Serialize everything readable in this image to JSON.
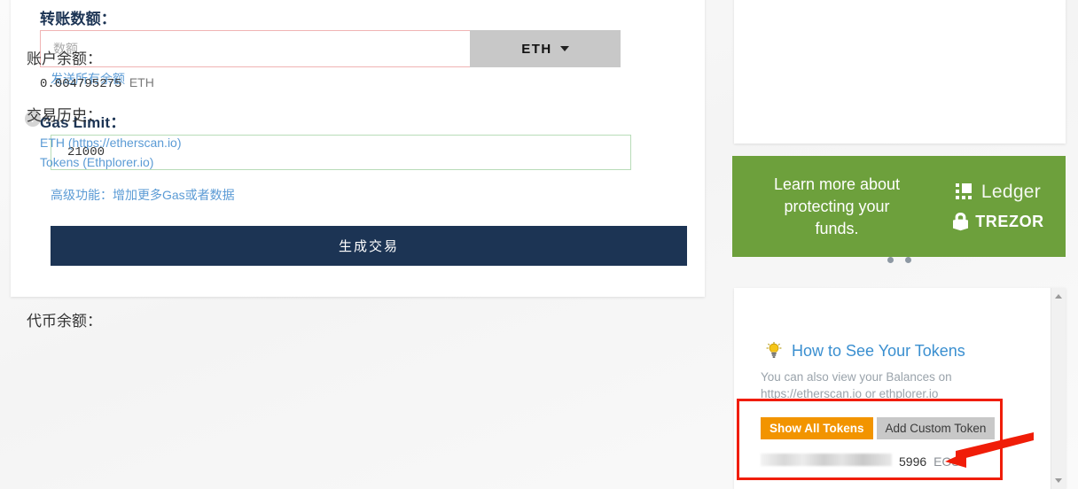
{
  "send_form": {
    "amount_label": "转账数额：",
    "amount_placeholder": "数额",
    "amount_value": "",
    "unit_button": "ETH",
    "send_all_link": "发送所有余额",
    "gas_label": "Gas Limit：",
    "gas_help_icon": "question-mark-icon",
    "gas_value": "21000",
    "advanced_link": "高级功能：增加更多Gas或者数据",
    "generate_button": "生成交易"
  },
  "balance_card": {
    "balance_heading": "账户余额：",
    "balance_value": "0.004795275",
    "balance_unit": "ETH",
    "history_heading": "交易历史：",
    "history_links": [
      "ETH (https://etherscan.io)",
      "Tokens (Ethplorer.io)"
    ]
  },
  "promo": {
    "text_line1": "Learn more about",
    "text_line2": "protecting your",
    "text_line3": "funds.",
    "ledger_label": "Ledger",
    "trezor_label": "TREZOR",
    "background_color": "#6da03c",
    "dots": 2,
    "active_dot_index": 1
  },
  "token_card": {
    "heading": "代币余额：",
    "how_to_link": "How to See Your Tokens",
    "bulb_icon": "lightbulb-icon",
    "note_line1": "You can also view your Balances on",
    "note_line2": "https://etherscan.io or ethplorer.io",
    "show_all_button": "Show All Tokens",
    "add_custom_button": "Add Custom Token",
    "token_row": {
      "name_redacted": true,
      "amount": "5996",
      "symbol": "EOS"
    },
    "scrollbar": {
      "up_arrow": "scroll-up-arrow-icon",
      "down_arrow": "scroll-down-arrow-icon"
    }
  },
  "annotations": {
    "box_color": "#f01d08",
    "arrow_color": "#f01d08"
  },
  "colors": {
    "primary_navy": "#1c3454",
    "link_blue": "#5b9bd5",
    "accent_orange": "#f29400",
    "promo_green": "#6da03c",
    "error_red_border": "#f0b4b4",
    "valid_green_border": "#b8dcb8"
  }
}
